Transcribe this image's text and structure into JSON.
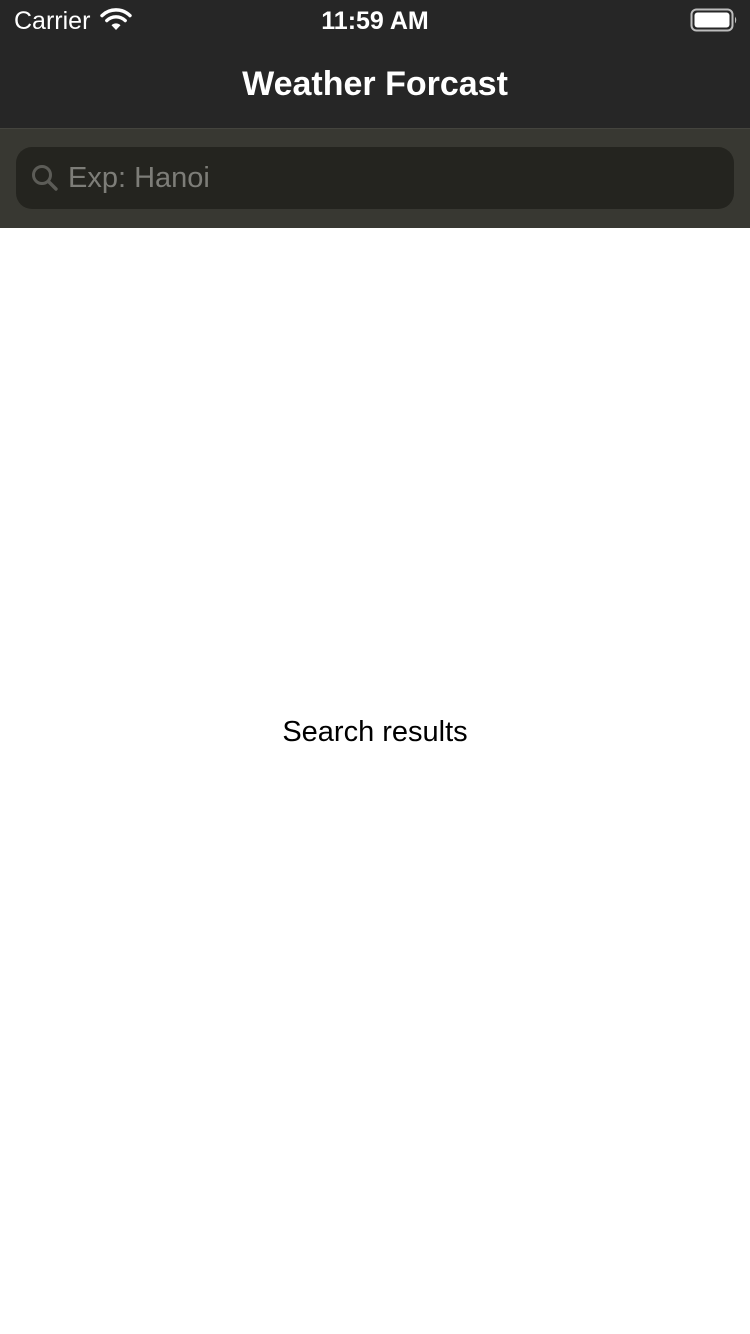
{
  "status_bar": {
    "carrier": "Carrier",
    "time": "11:59 AM",
    "icons": [
      "wifi-icon",
      "battery-icon"
    ]
  },
  "nav": {
    "title": "Weather Forcast"
  },
  "search": {
    "placeholder": "Exp: Hanoi",
    "value": "",
    "icon": "search-icon"
  },
  "content": {
    "results_label": "Search results"
  },
  "colors": {
    "nav_background": "#262626",
    "search_bar_background": "#383832",
    "search_field_background": "#24241f",
    "placeholder_text": "#7d7d78",
    "content_background": "#ffffff"
  }
}
